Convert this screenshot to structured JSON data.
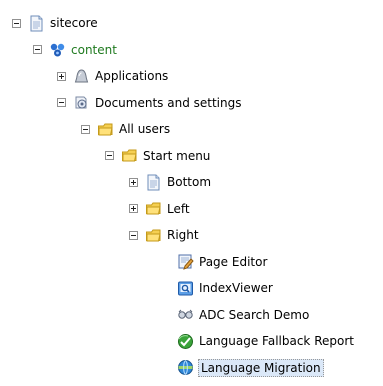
{
  "tree": {
    "items": [
      {
        "label": "sitecore",
        "icon": "document-icon",
        "toggle": "minus",
        "level": 0
      },
      {
        "label": "content",
        "icon": "content-icon",
        "toggle": "minus",
        "level": 1,
        "active": true
      },
      {
        "label": "Applications",
        "icon": "applications-icon",
        "toggle": "plus",
        "level": 2
      },
      {
        "label": "Documents and settings",
        "icon": "documents-settings-icon",
        "toggle": "minus",
        "level": 2
      },
      {
        "label": "All users",
        "icon": "folder-icon",
        "toggle": "minus",
        "level": 3
      },
      {
        "label": "Start menu",
        "icon": "folder-icon",
        "toggle": "minus",
        "level": 4
      },
      {
        "label": "Bottom",
        "icon": "document-icon",
        "toggle": "plus",
        "level": 5
      },
      {
        "label": "Left",
        "icon": "folder-icon",
        "toggle": "plus",
        "level": 5
      },
      {
        "label": "Right",
        "icon": "folder-icon",
        "toggle": "minus",
        "level": 5
      },
      {
        "label": "Page Editor",
        "icon": "page-editor-icon",
        "toggle": "none",
        "level": 6
      },
      {
        "label": "IndexViewer",
        "icon": "index-viewer-icon",
        "toggle": "none",
        "level": 6
      },
      {
        "label": "ADC Search Demo",
        "icon": "search-demo-icon",
        "toggle": "none",
        "level": 6
      },
      {
        "label": "Language Fallback Report",
        "icon": "language-fallback-icon",
        "toggle": "none",
        "level": 6
      },
      {
        "label": "Language Migration",
        "icon": "language-migration-icon",
        "toggle": "none",
        "level": 6,
        "selected": true
      }
    ]
  },
  "colors": {
    "active_text": "#1f7a1f",
    "selection_bg": "#dbe8f8",
    "toggle_border": "#919191"
  }
}
